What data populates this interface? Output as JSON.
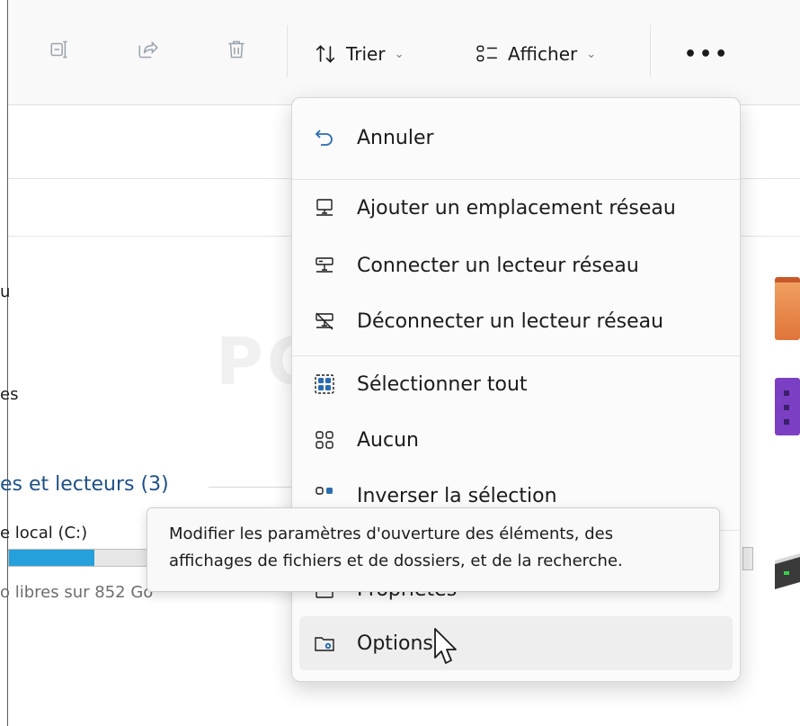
{
  "toolbar": {
    "sort_label": "Trier",
    "view_label": "Afficher",
    "more_label": "•••",
    "icons": [
      "rename-icon",
      "share-icon",
      "delete-icon",
      "sort-icon",
      "view-icon"
    ]
  },
  "left": {
    "item1_partial": "u",
    "item2_partial": "es",
    "drives_header": "es et lecteurs (3)",
    "drive_name": "e local (C:)",
    "drive_free": "o libres sur 852 Go",
    "drive_usage_fraction": 0.6
  },
  "menu": {
    "undo": "Annuler",
    "add_network_location": "Ajouter un emplacement réseau",
    "map_network_drive": "Connecter un lecteur réseau",
    "disconnect_network_drive": "Déconnecter un lecteur réseau",
    "select_all": "Sélectionner tout",
    "select_none": "Aucun",
    "invert_selection": "Inverser la sélection",
    "properties": "Propriétés",
    "options": "Options"
  },
  "tooltip": {
    "line1": "Modifier les paramètres d'ouverture des éléments, des",
    "line2": "affichages de fichiers et de dossiers, et de la recherche."
  },
  "watermark": "PC ASTUCES",
  "colors": {
    "accent": "#26a0da",
    "header_link": "#1f4f86",
    "menu_icon_blue": "#2b6cb0"
  }
}
